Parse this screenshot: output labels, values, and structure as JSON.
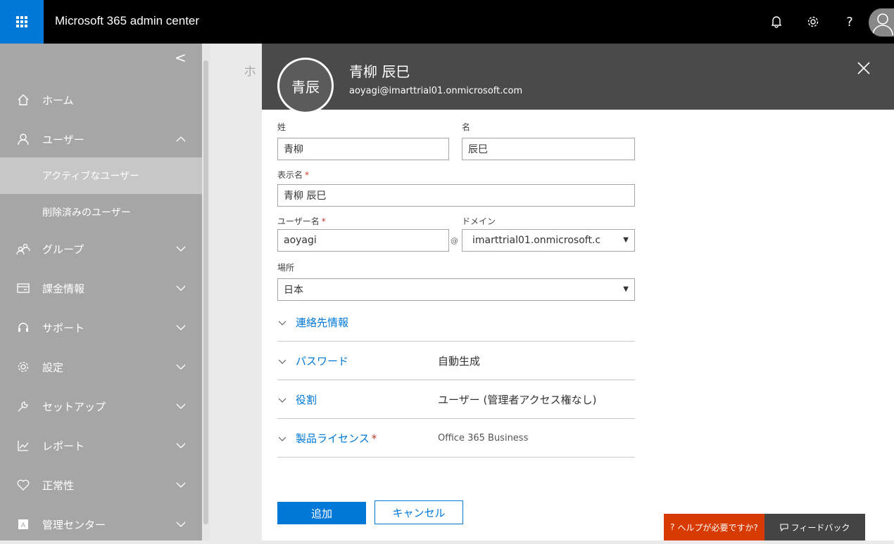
{
  "app": {
    "title": "Microsoft 365 admin center"
  },
  "topbar": {
    "icons": [
      "bell-icon",
      "gear-icon",
      "help-icon",
      "account-icon"
    ],
    "help_glyph": "?"
  },
  "sidebar": {
    "collapse_glyph": "<",
    "items": [
      {
        "label": "ホーム",
        "icon": "home-icon"
      },
      {
        "label": "ユーザー",
        "icon": "user-icon",
        "expanded": true
      },
      {
        "label": "グループ",
        "icon": "group-icon"
      },
      {
        "label": "課金情報",
        "icon": "card-icon"
      },
      {
        "label": "サポート",
        "icon": "headset-icon"
      },
      {
        "label": "設定",
        "icon": "gear-icon"
      },
      {
        "label": "セットアップ",
        "icon": "wrench-icon"
      },
      {
        "label": "レポート",
        "icon": "chart-icon"
      },
      {
        "label": "正常性",
        "icon": "heart-icon"
      },
      {
        "label": "管理センター",
        "icon": "admin-icon"
      }
    ],
    "sub_items": [
      {
        "label": "アクティブなユーザー",
        "active": true
      },
      {
        "label": "削除済みのユーザー",
        "active": false
      }
    ]
  },
  "main": {
    "breadcrumb_partial": "ホ"
  },
  "panel": {
    "initials": "青辰",
    "name": "青柳 辰巳",
    "email": "aoyagi@imarttrial01.onmicrosoft.com",
    "form": {
      "last_name_label": "姓",
      "last_name_value": "青柳",
      "first_name_label": "名",
      "first_name_value": "辰巳",
      "display_name_label": "表示名",
      "display_name_value": "青柳 辰巳",
      "username_label": "ユーザー名",
      "username_value": "aoyagi",
      "at_symbol": "@",
      "domain_label": "ドメイン",
      "domain_value": "imarttrial01.onmicrosoft.c",
      "location_label": "場所",
      "location_value": "日本",
      "required_mark": "*"
    },
    "sections": [
      {
        "title": "連絡先情報",
        "value": ""
      },
      {
        "title": "パスワード",
        "value": "自動生成"
      },
      {
        "title": "役割",
        "value": "ユーザー (管理者アクセス権なし)"
      },
      {
        "title": "製品ライセンス",
        "value": "Office 365 Business",
        "required": true
      }
    ],
    "buttons": {
      "add": "追加",
      "cancel": "キャンセル"
    }
  },
  "footer": {
    "help": "ヘルプが必要ですか?",
    "feedback": "フィードバック"
  },
  "colors": {
    "accent": "#0078d7",
    "header": "#4a4a4a",
    "sidebar": "#a6a6a6",
    "help": "#d83b01"
  }
}
